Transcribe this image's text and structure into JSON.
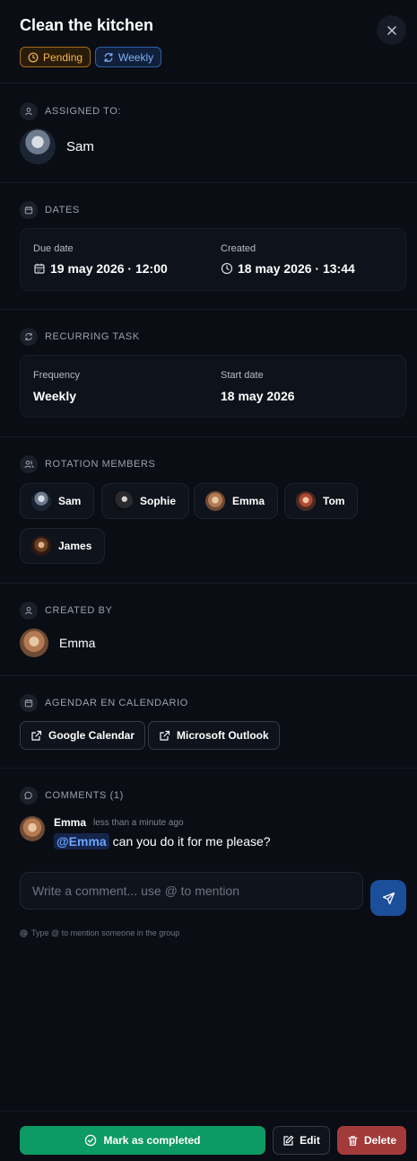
{
  "task": {
    "title": "Clean the kitchen",
    "status_badge": "Pending",
    "recurrence_badge": "Weekly"
  },
  "sections": {
    "assigned_to": "ASSIGNED TO:",
    "dates": "DATES",
    "recurring": "RECURRING TASK",
    "rotation": "ROTATION MEMBERS",
    "created_by": "CREATED BY",
    "calendar": "AGENDAR EN CALENDARIO",
    "comments": "COMMENTS (1)"
  },
  "assignee": {
    "name": "Sam"
  },
  "dates": {
    "due_label": "Due date",
    "due_value": "19 may 2026 · 12:00",
    "created_label": "Created",
    "created_value": "18 may 2026 · 13:44"
  },
  "recurring": {
    "frequency_label": "Frequency",
    "frequency_value": "Weekly",
    "start_label": "Start date",
    "start_value": "18 may 2026"
  },
  "rotation_members": [
    "Sam",
    "Sophie",
    "Emma",
    "Tom",
    "James"
  ],
  "creator": {
    "name": "Emma"
  },
  "calendar_buttons": {
    "google": "Google Calendar",
    "outlook": "Microsoft Outlook"
  },
  "comments": [
    {
      "author": "Emma",
      "time": "less than a minute ago",
      "mention": "@Emma",
      "text": "can you do it for me please?"
    }
  ],
  "comment_input": {
    "placeholder": "Write a comment... use @ to mention",
    "hint": "Type @ to mention someone in the group"
  },
  "actions": {
    "complete": "Mark as completed",
    "edit": "Edit",
    "delete": "Delete"
  },
  "icons": {
    "close": "close-icon",
    "clock": "clock-icon",
    "repeat": "repeat-icon",
    "user": "user-icon",
    "calendar": "calendar-icon",
    "users": "users-icon",
    "external": "external-link-icon",
    "message": "message-icon",
    "at": "at-icon",
    "send": "send-icon",
    "check": "check-circle-icon",
    "pencil": "pencil-icon",
    "trash": "trash-icon"
  },
  "colors": {
    "background": "#0a0d14",
    "pending": "#f6b54a",
    "weekly": "#7eb0f5",
    "complete": "#0e9a64",
    "delete": "#a33a3a",
    "send": "#1c4f99"
  }
}
